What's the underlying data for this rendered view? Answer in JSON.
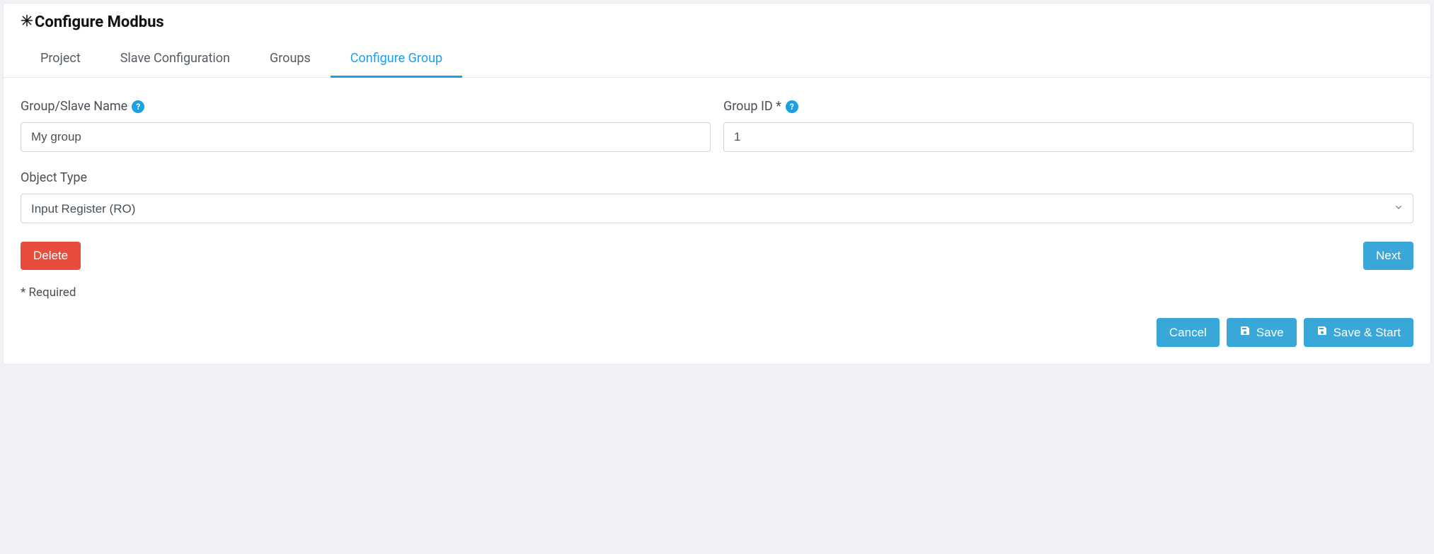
{
  "header": {
    "title": "Configure Modbus"
  },
  "tabs": [
    {
      "label": "Project",
      "active": false
    },
    {
      "label": "Slave Configuration",
      "active": false
    },
    {
      "label": "Groups",
      "active": false
    },
    {
      "label": "Configure Group",
      "active": true
    }
  ],
  "form": {
    "group_name": {
      "label": "Group/Slave Name",
      "value": "My group",
      "help": "?"
    },
    "group_id": {
      "label": "Group ID *",
      "value": "1",
      "help": "?"
    },
    "object_type": {
      "label": "Object Type",
      "value": "Input Register (RO)"
    }
  },
  "buttons": {
    "delete": "Delete",
    "next": "Next",
    "cancel": "Cancel",
    "save": "Save",
    "save_start": "Save & Start"
  },
  "required_note": "* Required"
}
